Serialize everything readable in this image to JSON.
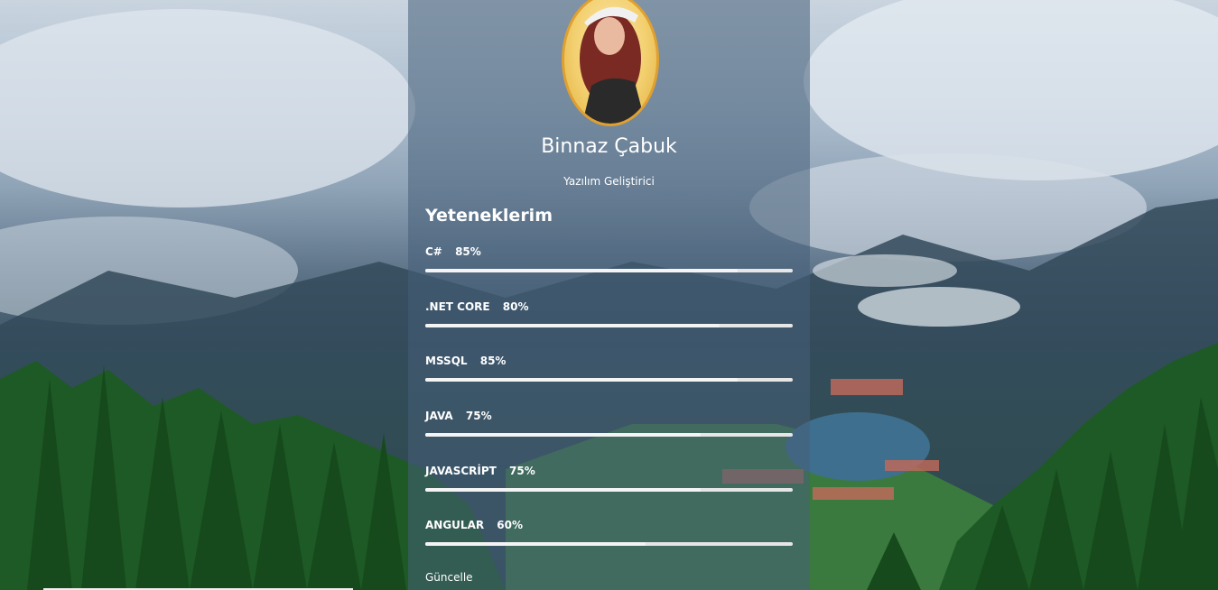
{
  "profile": {
    "name": "Binnaz Çabuk",
    "role": "Yazılım Geliştirici",
    "avatar_border_color": "#e0a030"
  },
  "skills": {
    "title": "Yeteneklerim",
    "items": [
      {
        "label": "C#",
        "percent_text": "85%",
        "percent": 85
      },
      {
        "label": ".NET CORE",
        "percent_text": "80%",
        "percent": 80
      },
      {
        "label": "MSSQL",
        "percent_text": "85%",
        "percent": 85
      },
      {
        "label": "JAVA",
        "percent_text": "75%",
        "percent": 75
      },
      {
        "label": "JAVASCRİPT",
        "percent_text": "75%",
        "percent": 75
      },
      {
        "label": "ANGULAR",
        "percent_text": "60%",
        "percent": 60
      }
    ]
  },
  "actions": {
    "update_label": "Güncelle"
  }
}
